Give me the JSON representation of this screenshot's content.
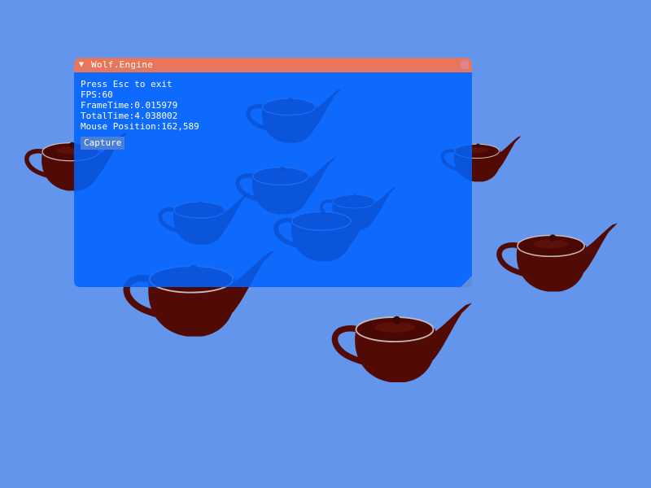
{
  "viewport": {
    "clear_color": "#6495ed",
    "scene": {
      "object": "teapot",
      "object_color": "#520a04",
      "count": 11
    }
  },
  "window": {
    "title": "Wolf.Engine",
    "title_bar_color": "#e8765a",
    "body_color": "#0062ff",
    "collapse_icon": "triangle-down-icon",
    "close_icon": "close-box-icon",
    "lines": [
      "Press Esc to exit",
      "FPS:60",
      "FrameTime:0.015979",
      "TotalTime:4.038002",
      "Mouse Position:162,589"
    ],
    "capture_label": "Capture"
  }
}
